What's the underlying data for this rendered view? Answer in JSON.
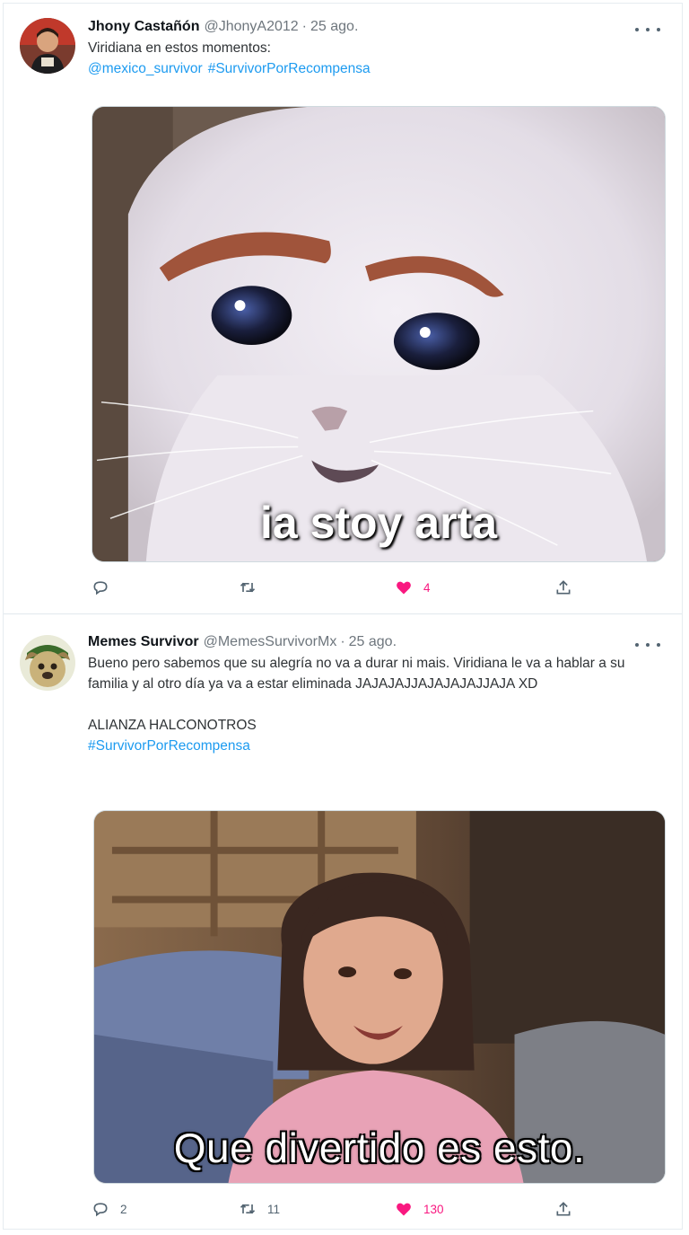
{
  "colors": {
    "link": "#1d9bf0",
    "like": "#f91880",
    "muted": "#6e767d"
  },
  "tweets": [
    {
      "name": "Jhony Castañón",
      "handle": "@JhonyA2012",
      "separator": "·",
      "date": "25 ago.",
      "text": "Viridiana en estos momentos:",
      "links": [
        "@mexico_survivor",
        "#SurvivorPorRecompensa"
      ],
      "media_caption": "ia stoy arta",
      "actions": {
        "replies": "",
        "retweets": "",
        "likes": "4"
      },
      "icons": {
        "reply": "reply-icon",
        "retweet": "retweet-icon",
        "like": "heart-icon",
        "share": "share-icon",
        "more": "more-icon"
      }
    },
    {
      "name": "Memes Survivor",
      "handle": "@MemesSurvivorMx",
      "separator": "·",
      "date": "25 ago.",
      "text": "Bueno pero sabemos que su alegría no va a durar ni mais. Viridiana le va a hablar a su familia y al otro día ya va a estar eliminada JAJAJAJJAJAJAJAJJAJA XD\n\nALIANZA HALCONOTROS",
      "links": [
        "#SurvivorPorRecompensa"
      ],
      "media_caption": "Que divertido es esto.",
      "actions": {
        "replies": "2",
        "retweets": "11",
        "likes": "130"
      },
      "icons": {
        "reply": "reply-icon",
        "retweet": "retweet-icon",
        "like": "heart-icon",
        "share": "share-icon",
        "more": "more-icon"
      }
    }
  ]
}
